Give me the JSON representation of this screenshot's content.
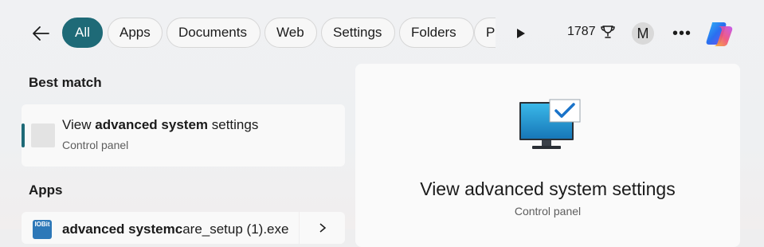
{
  "top_bar": {
    "filters": [
      {
        "label": "All",
        "active": true
      },
      {
        "label": "Apps"
      },
      {
        "label": "Documents"
      },
      {
        "label": "Web"
      },
      {
        "label": "Settings"
      },
      {
        "label": "Folders"
      },
      {
        "label": "Ph"
      }
    ],
    "points": "1787",
    "avatar_initial": "M",
    "more_label": "•••",
    "icons": {
      "back": "arrow-left-icon",
      "play": "play-icon",
      "points": "trophy-icon",
      "copilot": "copilot-icon"
    }
  },
  "results": {
    "best_match_heading": "Best match",
    "best_match": {
      "title_prefix": "View ",
      "title_bold": "advanced system",
      "title_suffix": " settings",
      "subtitle": "Control panel"
    },
    "apps_heading": "Apps",
    "app_item": {
      "icon_text": "IO​Bit",
      "title_bold": "advanced systemc",
      "title_rest": "are_setup (1).exe"
    }
  },
  "preview": {
    "title": "View advanced system settings",
    "subtitle": "Control panel",
    "icon": "monitor-check-icon"
  },
  "colors": {
    "accent": "#1e6a77",
    "chip_bg": "#f7f7f7",
    "panel_bg": "#fafafa"
  }
}
